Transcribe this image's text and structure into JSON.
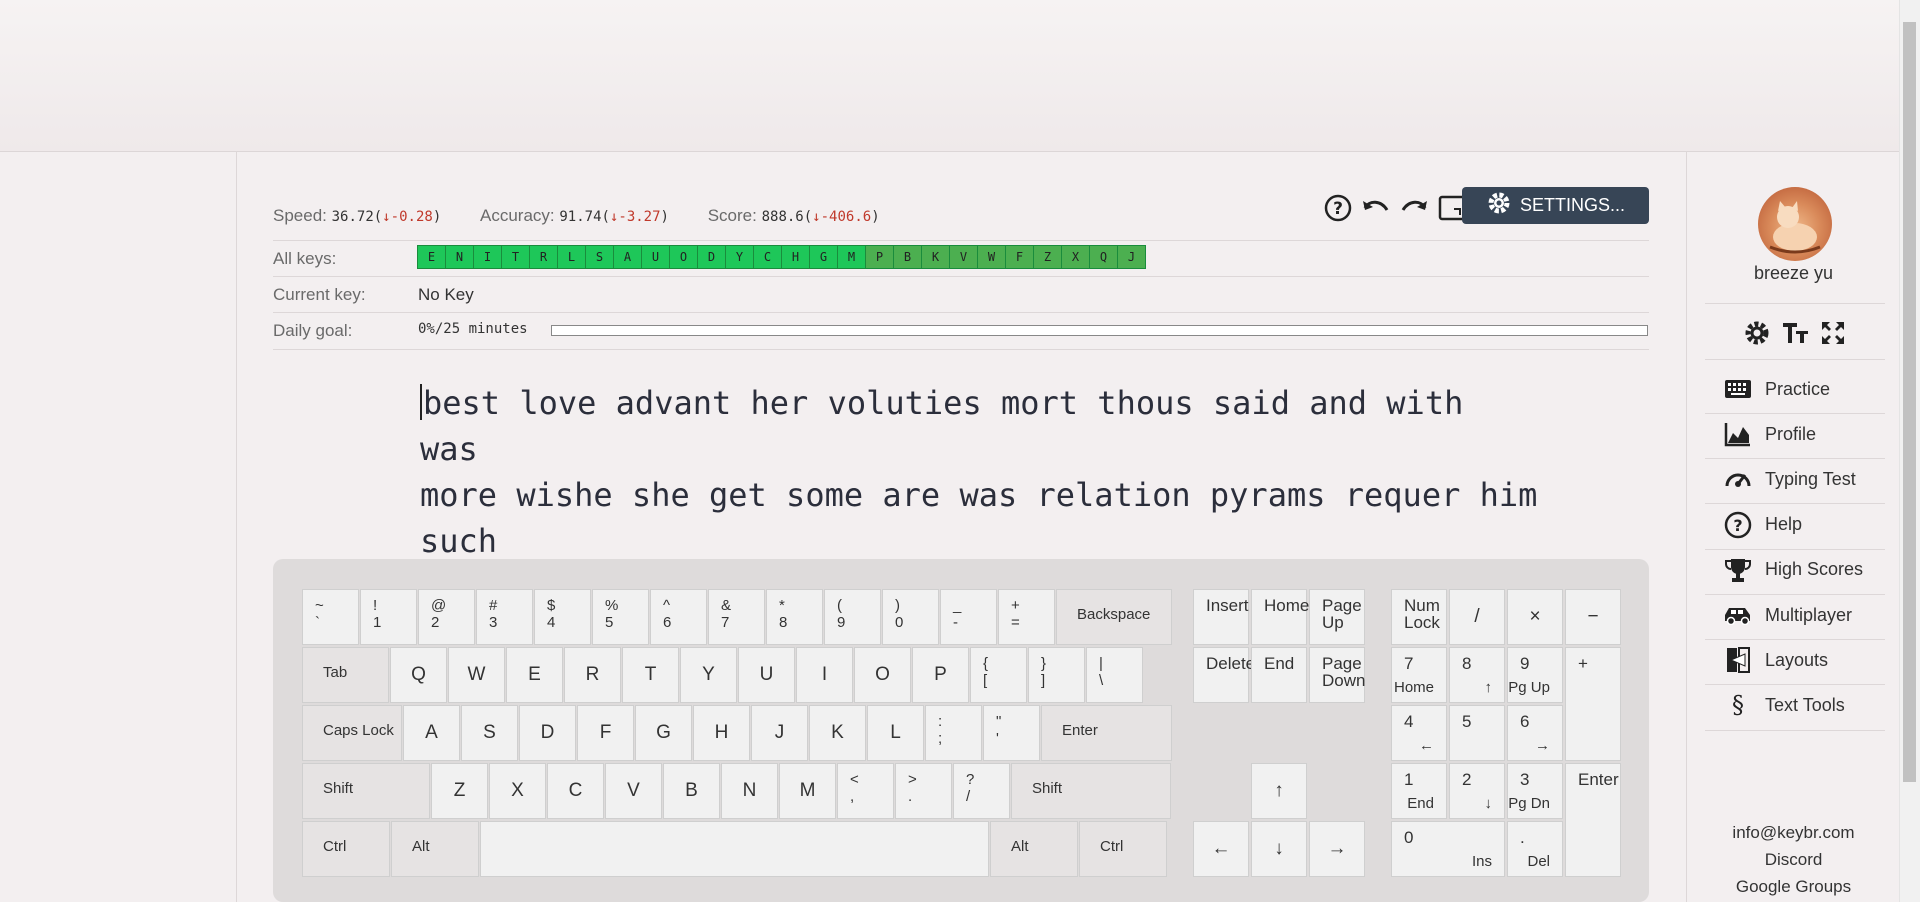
{
  "stats": {
    "speed_label": "Speed:",
    "speed_value": "36.72",
    "speed_delta": "-0.28",
    "accuracy_label": "Accuracy:",
    "accuracy_value": "91.74",
    "accuracy_delta": "-3.27",
    "score_label": "Score:",
    "score_value": "888.6",
    "score_delta": "-406.6"
  },
  "toolbar": {
    "settings_label": "SETTINGS..."
  },
  "rows": {
    "all_keys_label": "All keys:",
    "all_keys": [
      "E",
      "N",
      "I",
      "T",
      "R",
      "L",
      "S",
      "A",
      "U",
      "O",
      "D",
      "Y",
      "C",
      "H",
      "G",
      "M",
      "P",
      "B",
      "K",
      "V",
      "W",
      "F",
      "Z",
      "X",
      "Q",
      "J"
    ],
    "current_key_label": "Current key:",
    "current_key_value": "No Key",
    "daily_goal_label": "Daily goal:",
    "daily_goal_value": "0%/25 minutes",
    "daily_goal_progress": 0
  },
  "typing_text": {
    "line1": "best love advant her voluties mort thous said and with was",
    "line2": "more wishe she get some are was relation pyrams requer him",
    "line3": "such"
  },
  "keyboard": {
    "row1": [
      [
        "~",
        "`"
      ],
      [
        "!",
        "1"
      ],
      [
        "@",
        "2"
      ],
      [
        "#",
        "3"
      ],
      [
        "$",
        "4"
      ],
      [
        "%",
        "5"
      ],
      [
        "^",
        "6"
      ],
      [
        "&",
        "7"
      ],
      [
        "*",
        "8"
      ],
      [
        "(",
        "9"
      ],
      [
        ")",
        "0"
      ],
      [
        "_",
        "-"
      ],
      [
        "+",
        "="
      ]
    ],
    "backspace": "Backspace",
    "tab": "Tab",
    "row2": [
      "Q",
      "W",
      "E",
      "R",
      "T",
      "Y",
      "U",
      "I",
      "O",
      "P"
    ],
    "row2_sym": [
      [
        "{",
        "["
      ],
      [
        "}",
        "]"
      ],
      [
        "|",
        "\\"
      ]
    ],
    "caps": "Caps Lock",
    "row3": [
      "A",
      "S",
      "D",
      "F",
      "G",
      "H",
      "J",
      "K",
      "L"
    ],
    "row3_sym": [
      [
        ":",
        ";"
      ],
      [
        "\"",
        "'"
      ]
    ],
    "enter": "Enter",
    "shift": "Shift",
    "row4": [
      "Z",
      "X",
      "C",
      "V",
      "B",
      "N",
      "M"
    ],
    "row4_sym": [
      [
        "<",
        ","
      ],
      [
        ">",
        "."
      ],
      [
        "?",
        "/"
      ]
    ],
    "ctrl": "Ctrl",
    "alt": "Alt",
    "nav": {
      "insert": "Insert",
      "home": "Home",
      "pgup": "Page\nUp",
      "delete": "Delete",
      "end": "End",
      "pgdn": "Page\nDown"
    },
    "arrows": {
      "up": "↑",
      "left": "←",
      "down": "↓",
      "right": "→"
    },
    "numpad": {
      "numlock": "Num\nLock",
      "div": "/",
      "mul": "×",
      "minus": "−",
      "plus": "+",
      "enter": "Enter",
      "n7": "7",
      "n7b": "Home",
      "n8": "8",
      "n8b": "↑",
      "n9": "9",
      "n9b": "Pg Up",
      "n4": "4",
      "n4b": "←",
      "n5": "5",
      "n6": "6",
      "n6b": "→",
      "n1": "1",
      "n1b": "End",
      "n2": "2",
      "n2b": "↓",
      "n3": "3",
      "n3b": "Pg Dn",
      "n0": "0",
      "n0b": "Ins",
      "dot": ".",
      "dotb": "Del"
    }
  },
  "sidebar": {
    "username": "breeze yu",
    "nav": [
      "Practice",
      "Profile",
      "Typing Test",
      "Help",
      "High Scores",
      "Multiplayer",
      "Layouts",
      "Text Tools"
    ],
    "email": "info@keybr.com",
    "discord": "Discord",
    "groups": "Google Groups"
  },
  "colors": {
    "settings_bg": "#374556",
    "key_green": "#1ec759",
    "key_green_dark": "#4caf50"
  }
}
